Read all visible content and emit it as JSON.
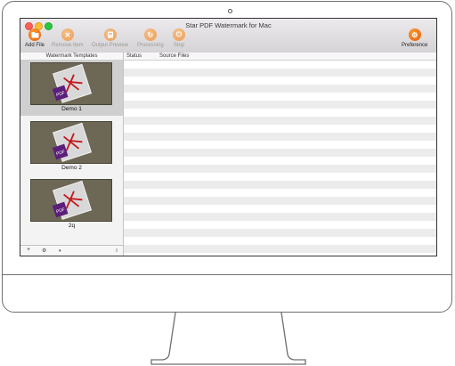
{
  "window": {
    "title": "Star PDF Watermark for Mac"
  },
  "toolbar": {
    "add_file": "Add File",
    "remove_item": "Remove Item",
    "output_preview": "Output Preview",
    "processing": "Processing",
    "stop": "Stop",
    "preference": "Preference"
  },
  "left_panel": {
    "header": "Watermark Templates",
    "templates": [
      {
        "name": "Demo 1",
        "selected": true
      },
      {
        "name": "Demo 2",
        "selected": false
      },
      {
        "name": "2q",
        "selected": false
      }
    ],
    "bottom": {
      "add": "+",
      "gear": "⚙",
      "chevron": "▾",
      "resize": "⦙⦙"
    }
  },
  "table": {
    "columns": [
      "Status",
      "Source Files"
    ]
  },
  "thumb_label": "PDF",
  "colors": {
    "accent": "#f07a1a",
    "selection": "#cfcfcf"
  }
}
